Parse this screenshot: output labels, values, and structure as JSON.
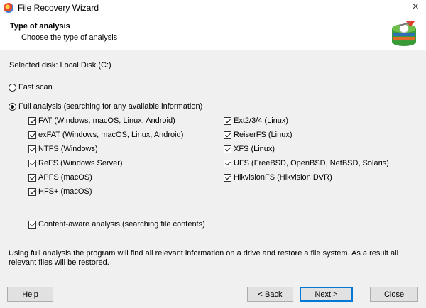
{
  "window": {
    "title": "File Recovery Wizard",
    "close_glyph": "×"
  },
  "header": {
    "title": "Type of analysis",
    "subtitle": "Choose the type of analysis",
    "logo": "recovery-disk-logo"
  },
  "disk": {
    "label": "Selected disk: Local Disk (C:)"
  },
  "scan": {
    "fast": {
      "label": "Fast scan",
      "selected": false
    },
    "full": {
      "label": "Full analysis (searching for any available information)",
      "selected": true
    }
  },
  "filesystems_left": [
    {
      "label": "FAT (Windows, macOS, Linux, Android)",
      "checked": true
    },
    {
      "label": "exFAT (Windows, macOS, Linux, Android)",
      "checked": true
    },
    {
      "label": "NTFS (Windows)",
      "checked": true
    },
    {
      "label": "ReFS (Windows Server)",
      "checked": true
    },
    {
      "label": "APFS (macOS)",
      "checked": true
    },
    {
      "label": "HFS+ (macOS)",
      "checked": true
    }
  ],
  "filesystems_right": [
    {
      "label": "Ext2/3/4 (Linux)",
      "checked": true
    },
    {
      "label": "ReiserFS (Linux)",
      "checked": true
    },
    {
      "label": "XFS (Linux)",
      "checked": true
    },
    {
      "label": "UFS (FreeBSD, OpenBSD, NetBSD, Solaris)",
      "checked": true
    },
    {
      "label": "HikvisionFS (Hikvision DVR)",
      "checked": true
    }
  ],
  "content_aware": {
    "label": "Content-aware analysis (searching file contents)",
    "checked": true
  },
  "description": "Using full analysis the program will find all relevant information on a drive and restore a file system. As a result all relevant files will be restored.",
  "buttons": {
    "help": "Help",
    "back": "< Back",
    "next": "Next >",
    "close": "Close"
  }
}
